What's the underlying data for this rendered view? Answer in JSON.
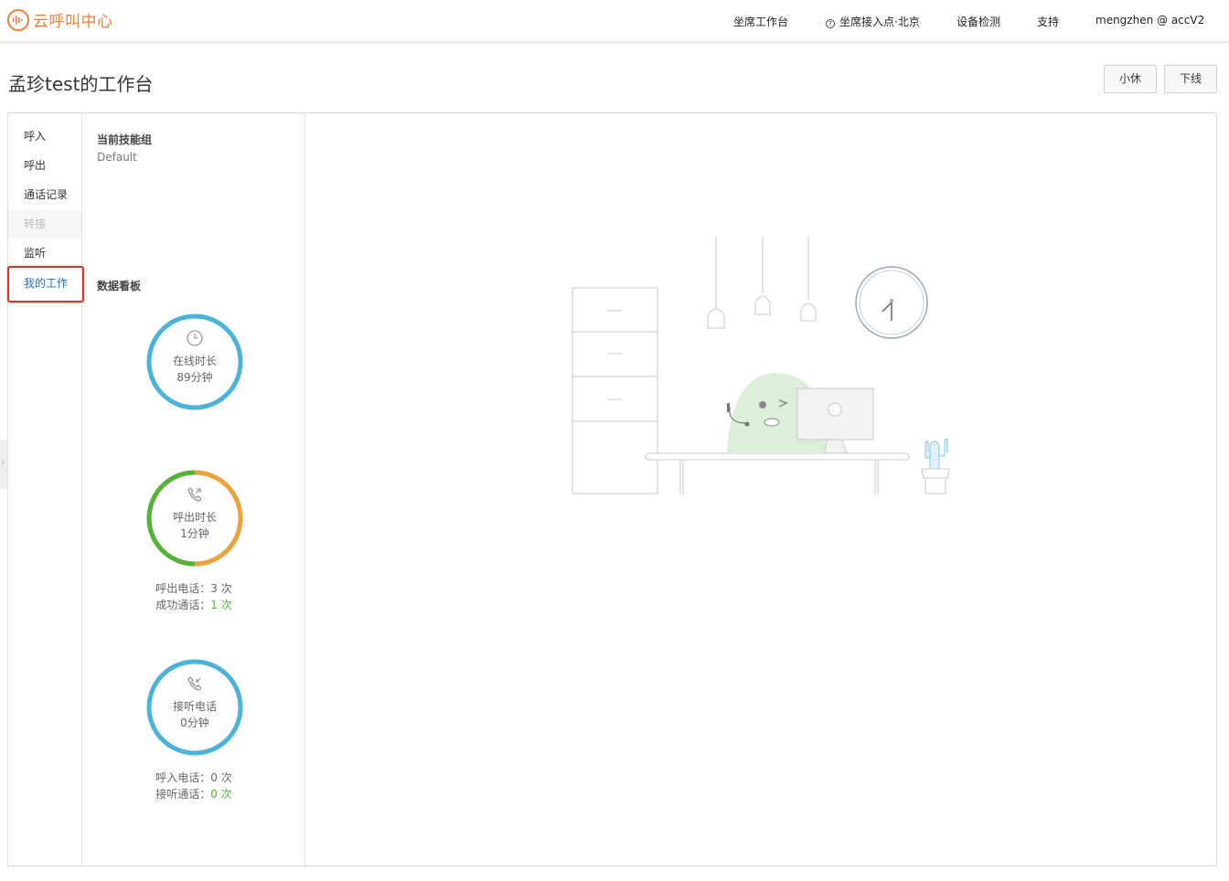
{
  "app": {
    "name": "云呼叫中心"
  },
  "nav": {
    "workbench": "坐席工作台",
    "access_point": "坐席接入点·北京",
    "device_check": "设备检测",
    "support": "支持",
    "user": "mengzhen @ accV2"
  },
  "page": {
    "title": "孟珍test的工作台",
    "break_button": "小休",
    "offline_button": "下线"
  },
  "sidebar": {
    "items": [
      {
        "label": "呼入",
        "state": "normal"
      },
      {
        "label": "呼出",
        "state": "normal"
      },
      {
        "label": "通话记录",
        "state": "normal"
      },
      {
        "label": "转接",
        "state": "disabled"
      },
      {
        "label": "监听",
        "state": "normal"
      },
      {
        "label": "我的工作",
        "state": "active"
      }
    ]
  },
  "stats": {
    "skill_group_label": "当前技能组",
    "skill_group_value": "Default",
    "dashboard_label": "数据看板",
    "online": {
      "title": "在线时长",
      "value": "89分钟",
      "color": "#4bb3d8"
    },
    "outbound": {
      "title": "呼出时长",
      "value": "1分钟",
      "calls_label": "呼出电话：",
      "calls_value": "3 次",
      "success_label": "成功通话：",
      "success_value": "1 次",
      "color_main": "#eba23a",
      "color_success": "#52b23a"
    },
    "inbound": {
      "title": "接听电话",
      "value": "0分钟",
      "calls_label": "呼入电话：",
      "calls_value": "0 次",
      "answered_label": "接听通话：",
      "answered_value": "0 次",
      "color": "#4bb3d8"
    }
  },
  "colors": {
    "brand": "#ef7e3a",
    "link": "#1c6fc2",
    "highlight_border": "#d6332b"
  }
}
